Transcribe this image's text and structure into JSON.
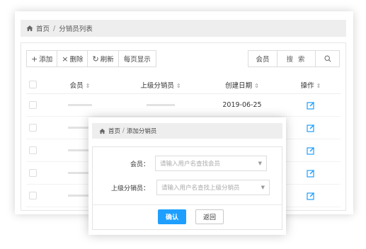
{
  "breadcrumb": {
    "home": "首页",
    "separator": "/",
    "current": "分销员列表"
  },
  "toolbar": {
    "add": "添加",
    "add_glyph": "+",
    "delete": "删除",
    "delete_glyph": "×",
    "refresh": "刷新",
    "refresh_glyph": "↻",
    "per_page": "每页显示"
  },
  "search": {
    "field": "会员",
    "placeholder": "搜 索",
    "icon": "search-icon"
  },
  "table": {
    "columns": {
      "member": "会员",
      "superior": "上级分销员",
      "date": "创建日期",
      "actions": "操作"
    },
    "sort_glyph": "⇕",
    "rows": [
      {
        "date": "2019-06-25"
      },
      {
        "date": ""
      },
      {
        "date": ""
      },
      {
        "date": ""
      },
      {
        "date": ""
      }
    ]
  },
  "dialog": {
    "breadcrumb": {
      "home": "首页",
      "separator": "/",
      "current": "添加分销员"
    },
    "member_label": "会员：",
    "member_placeholder": "请输入用户名查找会员",
    "superior_label": "上级分销员：",
    "superior_placeholder": "请输入用户名查找上级分销员",
    "confirm": "确认",
    "back": "返回"
  },
  "colors": {
    "primary": "#1e9fff",
    "edit_icon": "#1e9fff"
  }
}
